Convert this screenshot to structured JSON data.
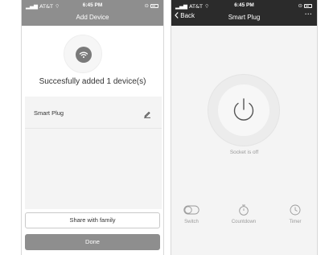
{
  "left_screen": {
    "status": {
      "carrier": "AT&T",
      "time": "6:45 PM"
    },
    "title": "Add Device",
    "success_message": "Succesfully added 1 device(s)",
    "device_name": "Smart Plug",
    "share_label": "Share with family",
    "done_label": "Done",
    "icons": [
      "wifi-icon",
      "edit-pencil-icon",
      "signal-icon",
      "battery-icon"
    ]
  },
  "right_screen": {
    "status": {
      "carrier": "AT&T",
      "time": "6:45 PM"
    },
    "back_label": "Back",
    "title": "Smart Plug",
    "more_label": "···",
    "socket_status": "Socket is off",
    "actions": [
      {
        "label": "Switch",
        "icon": "toggle-switch-icon"
      },
      {
        "label": "Countdown",
        "icon": "stopwatch-icon"
      },
      {
        "label": "Timer",
        "icon": "clock-icon"
      }
    ]
  },
  "colors": {
    "left_header": "#8e8e8e",
    "right_header": "#2b2b2b",
    "accent_gray": "#7a7a7a"
  }
}
